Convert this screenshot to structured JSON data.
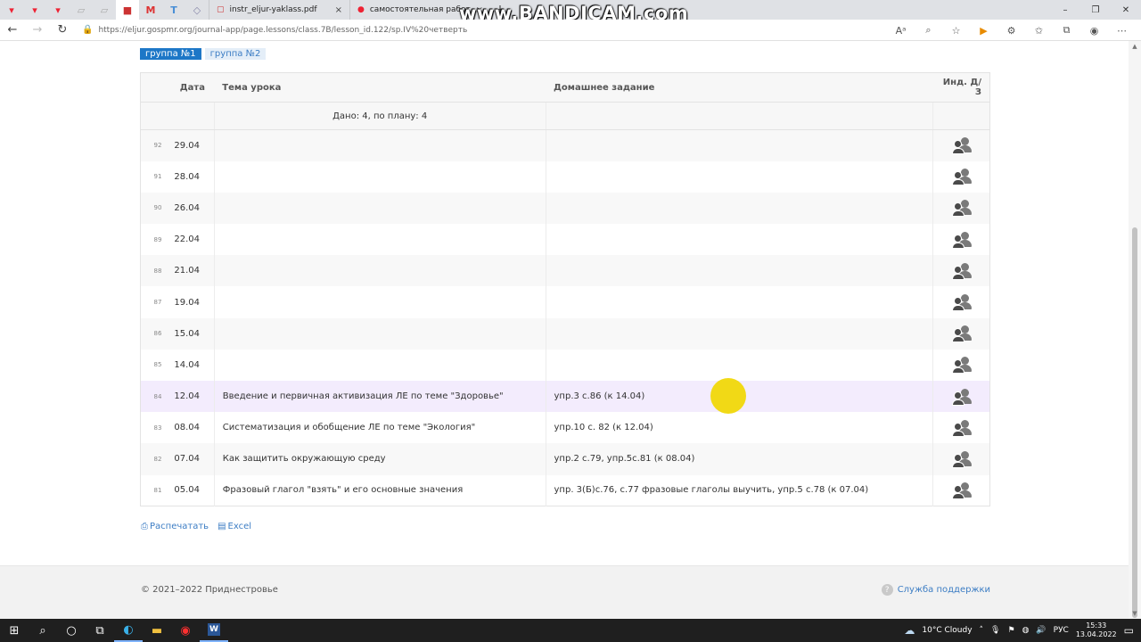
{
  "browser": {
    "pinned_tabs": [
      "yandex-icon",
      "yandex-icon",
      "yandex-icon",
      "doc-icon",
      "doc-icon",
      "bookmark-icon",
      "gmail-icon",
      "t-icon",
      "d-icon"
    ],
    "tabs": [
      {
        "label": "instr_eljur-yaklass.pdf",
        "close": "×"
      },
      {
        "label": "самостоятельная работа по ан",
        "close": "×"
      }
    ],
    "new_tab": "+",
    "url": "https://eljur.gospmr.org/journal-app/page.lessons/class.7B/lesson_id.122/sp.IV%20четверть",
    "window_controls": [
      "–",
      "❐",
      "✕"
    ]
  },
  "watermark": "www.BANDICAM.com",
  "groups": [
    {
      "label": "группа №1",
      "active": true
    },
    {
      "label": "группа №2",
      "active": false
    }
  ],
  "table": {
    "headers": {
      "date": "Дата",
      "topic": "Тема урока",
      "homework": "Домашнее задание",
      "ind": "Инд. Д/З"
    },
    "summary": "Дано: 4, по плану: 4",
    "rows": [
      {
        "num": "92",
        "date": "29.04",
        "topic": "",
        "hw": ""
      },
      {
        "num": "91",
        "date": "28.04",
        "topic": "",
        "hw": ""
      },
      {
        "num": "90",
        "date": "26.04",
        "topic": "",
        "hw": ""
      },
      {
        "num": "89",
        "date": "22.04",
        "topic": "",
        "hw": ""
      },
      {
        "num": "88",
        "date": "21.04",
        "topic": "",
        "hw": ""
      },
      {
        "num": "87",
        "date": "19.04",
        "topic": "",
        "hw": ""
      },
      {
        "num": "86",
        "date": "15.04",
        "topic": "",
        "hw": ""
      },
      {
        "num": "85",
        "date": "14.04",
        "topic": "",
        "hw": ""
      },
      {
        "num": "84",
        "date": "12.04",
        "topic": "Введение и первичная активизация ЛЕ по теме \"Здоровье\"",
        "hw": "упр.3 с.86 (к 14.04)",
        "highlight": true
      },
      {
        "num": "83",
        "date": "08.04",
        "topic": "Систематизация и обобщение ЛЕ по теме \"Экология\"",
        "hw": "упр.10 с. 82 (к 12.04)"
      },
      {
        "num": "82",
        "date": "07.04",
        "topic": "Как защитить окружающую среду",
        "hw": "упр.2 с.79, упр.5с.81 (к 08.04)"
      },
      {
        "num": "81",
        "date": "05.04",
        "topic": "Фразовый глагол \"взять\" и его основные значения",
        "hw": "упр. 3(Б)с.76, с.77 фразовые глаголы выучить, упр.5 с.78 (к 07.04)"
      }
    ]
  },
  "actions": {
    "print": "Распечатать",
    "excel": "Excel"
  },
  "footer": {
    "copyright": "© 2021–2022 Приднестровье",
    "support": "Служба поддержки"
  },
  "taskbar": {
    "weather": "10°C  Cloudy",
    "lang": "РУС",
    "time": "15:33",
    "date": "13.04.2022"
  },
  "colors": {
    "accent": "#1d77c7",
    "highlight_row": "#f3ecfd",
    "pointer": "#f0d80a"
  }
}
